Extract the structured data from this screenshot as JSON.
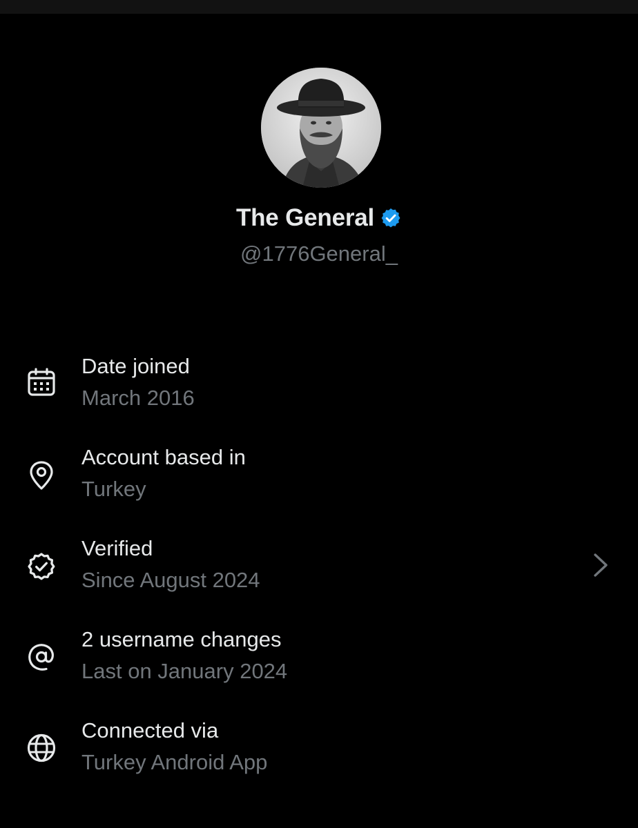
{
  "profile": {
    "display_name": "The General",
    "handle": "@1776General_",
    "verified_badge_color": "#1d9bf0",
    "avatar": "avatar-photo"
  },
  "colors": {
    "background": "#000000",
    "primary_text": "#e7e9ea",
    "secondary_text": "#71767b"
  },
  "rows": [
    {
      "icon": "calendar-icon",
      "title": "Date joined",
      "subtitle": "March 2016"
    },
    {
      "icon": "location-pin-icon",
      "title": "Account based in",
      "subtitle": "Turkey"
    },
    {
      "icon": "verified-check-icon",
      "title": "Verified",
      "subtitle": "Since August 2024",
      "chevron": "chevron-right-icon"
    },
    {
      "icon": "at-sign-icon",
      "title": "2 username changes",
      "subtitle": "Last on January 2024"
    },
    {
      "icon": "globe-icon",
      "title": "Connected via",
      "subtitle": "Turkey Android App"
    }
  ]
}
